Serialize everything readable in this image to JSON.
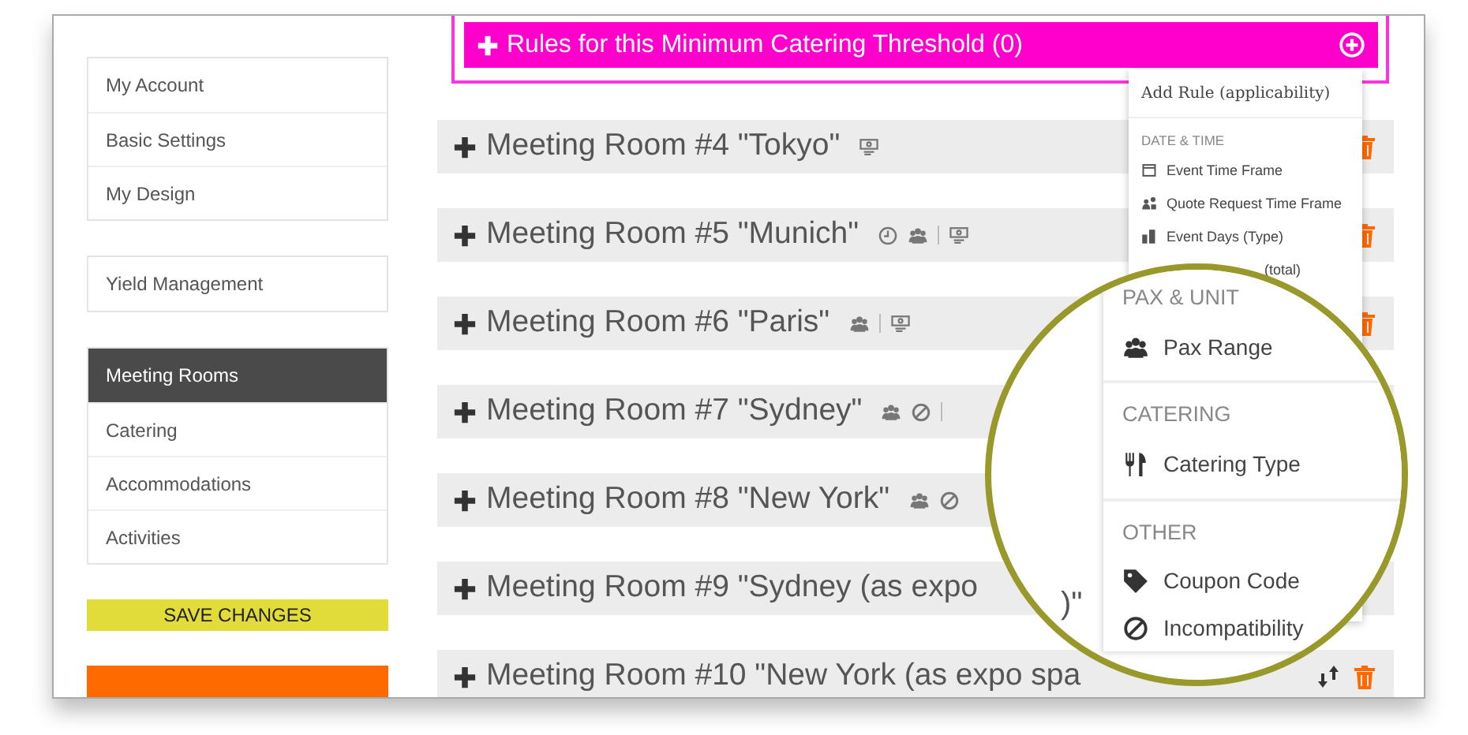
{
  "sidebar": {
    "groups": [
      [
        {
          "label": "My Account",
          "selected": false
        },
        {
          "label": "Basic Settings",
          "selected": false
        },
        {
          "label": "My Design",
          "selected": false
        }
      ],
      [
        {
          "label": "Yield Management",
          "selected": false
        }
      ],
      [
        {
          "label": "Meeting Rooms",
          "selected": true
        },
        {
          "label": "Catering",
          "selected": false
        },
        {
          "label": "Accommodations",
          "selected": false
        },
        {
          "label": "Activities",
          "selected": false
        }
      ]
    ]
  },
  "buttons": [
    {
      "kind": "save",
      "label": "SAVE CHANGES"
    },
    {
      "kind": "deploy"
    }
  ],
  "threshold": {
    "title": "Rules for this Minimum Catering Threshold (0)"
  },
  "rooms": [
    {
      "title": "Meeting Room #4 \"Tokyo\"",
      "badges": [
        {
          "kind": "screen"
        }
      ],
      "actions": [
        {
          "kind": "delete"
        }
      ]
    },
    {
      "title": "Meeting Room #5 \"Munich\"",
      "badges": [
        {
          "kind": "clock"
        },
        {
          "kind": "pax"
        },
        {
          "kind": "separator"
        },
        {
          "kind": "screen"
        }
      ],
      "actions": [
        {
          "kind": "delete"
        }
      ]
    },
    {
      "title": "Meeting Room #6 \"Paris\"",
      "badges": [
        {
          "kind": "pax"
        },
        {
          "kind": "separator"
        },
        {
          "kind": "screen"
        }
      ],
      "actions": [
        {
          "kind": "delete"
        }
      ]
    },
    {
      "title": "Meeting Room #7 \"Sydney\"",
      "badges": [
        {
          "kind": "pax"
        },
        {
          "kind": "ban"
        },
        {
          "kind": "separator"
        }
      ]
    },
    {
      "title": "Meeting Room #8 \"New York\"",
      "badges": [
        {
          "kind": "pax"
        },
        {
          "kind": "ban"
        }
      ]
    },
    {
      "title": "Meeting Room #9 \"Sydney (as expo"
    },
    {
      "title": "Meeting Room #10 \"New York (as expo spa",
      "actions": [
        {
          "kind": "move"
        },
        {
          "kind": "delete"
        }
      ]
    }
  ],
  "rule_menu": {
    "title": "Add Rule (applicability)",
    "sections": [
      {
        "header": "DATE & TIME",
        "items": [
          {
            "label": "Event Time Frame",
            "kind": "calendar"
          },
          {
            "label": "Quote Request Time Frame",
            "kind": "quote"
          },
          {
            "label": "Event Days (Type)",
            "kind": "days"
          },
          {
            "label": "(total)",
            "kind": "clipped"
          }
        ]
      }
    ]
  },
  "magnifier": {
    "fragment": ")\"",
    "sections": [
      {
        "header": "PAX & UNIT",
        "items": [
          {
            "label": "Pax Range",
            "kind": "pax"
          }
        ]
      },
      {
        "header": "CATERING",
        "items": [
          {
            "label": "Catering Type",
            "kind": "cutlery"
          }
        ]
      },
      {
        "header": "OTHER",
        "items": [
          {
            "label": "Coupon Code",
            "kind": "tag"
          },
          {
            "label": "Incompatibility",
            "kind": "ban"
          }
        ]
      }
    ]
  }
}
